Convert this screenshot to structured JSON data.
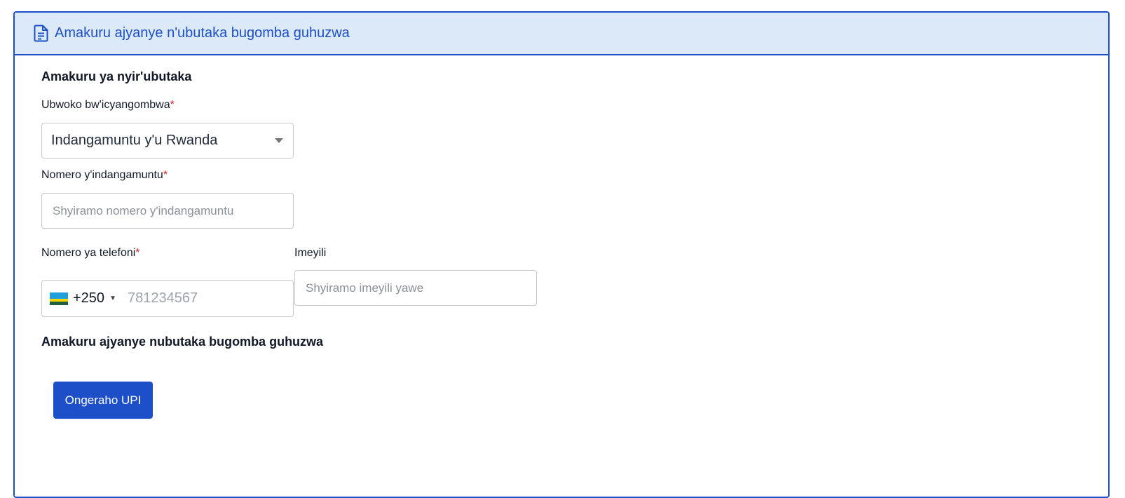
{
  "header": {
    "icon": "document-icon",
    "title": "Amakuru ajyanye n'ubutaka bugomba guhuzwa"
  },
  "owner_section": {
    "title": "Amakuru ya nyir'ubutaka"
  },
  "document_type": {
    "label": "Ubwoko bw'icyangombwa",
    "required_mark": "*",
    "selected_value": "Indangamuntu y'u Rwanda"
  },
  "id_number": {
    "label": "Nomero y'indangamuntu",
    "required_mark": "*",
    "value": "",
    "placeholder": "Shyiramo nomero y'indangamuntu"
  },
  "phone": {
    "label": "Nomero ya telefoni",
    "required_mark": "*",
    "country_flag": "rwanda-flag-icon",
    "dial_code": "+250",
    "value": "",
    "placeholder": "781234567"
  },
  "email": {
    "label": "Imeyili",
    "value": "",
    "placeholder": "Shyiramo imeyili yawe"
  },
  "parcel_section": {
    "title": "Amakuru ajyanye nubutaka bugomba guhuzwa"
  },
  "add_upi_button": {
    "label": "Ongeraho UPI"
  },
  "colors": {
    "primary": "#1d4fc8",
    "header_bg": "#dce9f8",
    "required": "#dc2626"
  }
}
